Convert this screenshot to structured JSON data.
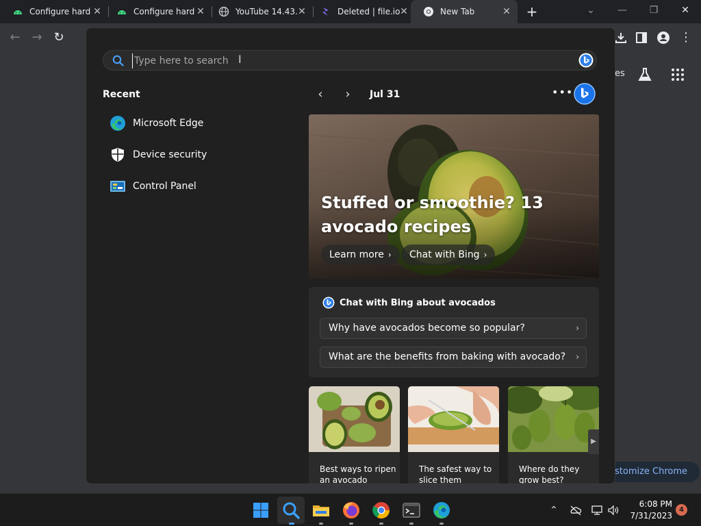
{
  "browser": {
    "tabs": [
      {
        "title": "Configure hard",
        "favicon": "android-icon"
      },
      {
        "title": "Configure hard",
        "favicon": "android-icon"
      },
      {
        "title": "YouTube 14.43.",
        "favicon": "globe-icon"
      },
      {
        "title": "Deleted | file.io",
        "favicon": "fileio-icon"
      },
      {
        "title": "New Tab",
        "favicon": "chrome-icon"
      }
    ],
    "page_partial_text": "es",
    "customize_label": "stomize Chrome"
  },
  "search_panel": {
    "placeholder": "Type here to search",
    "recent_title": "Recent",
    "recent_items": [
      {
        "label": "Microsoft Edge",
        "icon": "edge-icon"
      },
      {
        "label": "Device security",
        "icon": "shield-icon"
      },
      {
        "label": "Control Panel",
        "icon": "control-panel-icon"
      }
    ],
    "date": "Jul 31",
    "hero": {
      "title": "Stuffed or smoothie? 13 avocado recipes",
      "learn_more": "Learn more",
      "chat_with_bing": "Chat with Bing"
    },
    "chat_card": {
      "title": "Chat with Bing about avocados",
      "questions": [
        "Why have avocados become so popular?",
        "What are the benefits from baking with avocado?"
      ]
    },
    "thumbnails": [
      {
        "caption": "Best ways to ripen an avocado"
      },
      {
        "caption": "The safest way to slice them"
      },
      {
        "caption": "Where do they grow best?"
      }
    ]
  },
  "taskbar": {
    "time": "6:08 PM",
    "date": "7/31/2023",
    "notification_count": "4",
    "apps": [
      "start-icon",
      "search-icon",
      "file-explorer-icon",
      "firefox-icon",
      "chrome-icon",
      "terminal-icon",
      "edge-icon"
    ]
  },
  "colors": {
    "accent_blue": "#8ab4f8",
    "bing_blue": "#2f9bff",
    "panel_bg": "#202020",
    "avocado_green": "#9bb24a"
  }
}
